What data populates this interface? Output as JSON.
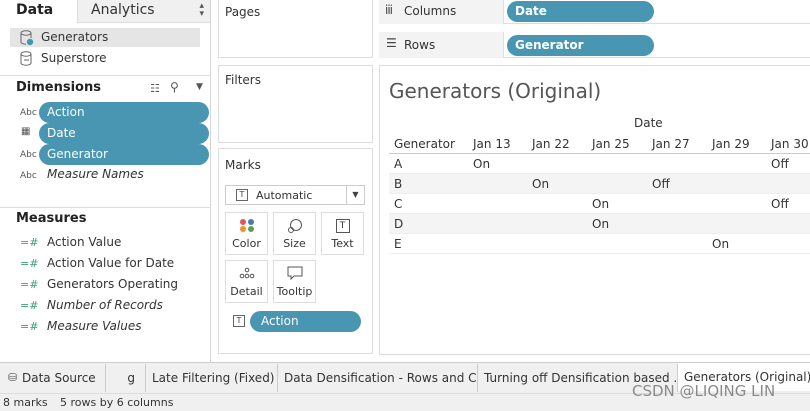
{
  "sidebar": {
    "tab_data": "Data",
    "tab_analytics": "Analytics",
    "datasources": [
      "Generators",
      "Superstore"
    ],
    "dimensions_title": "Dimensions",
    "dimensions": [
      {
        "type": "Abc",
        "label": "Action"
      },
      {
        "type": "date",
        "label": "Date"
      },
      {
        "type": "Abc",
        "label": "Generator"
      },
      {
        "type": "Abc",
        "label": "Measure Names"
      }
    ],
    "measures_title": "Measures",
    "measures": [
      "Action Value",
      "Action Value for Date",
      "Generators Operating",
      "Number of Records",
      "Measure Values"
    ]
  },
  "shelves": {
    "pages": "Pages",
    "filters": "Filters",
    "columns": "Columns",
    "rows": "Rows",
    "columns_pill": "Date",
    "rows_pill": "Generator"
  },
  "marks": {
    "title": "Marks",
    "type": "Automatic",
    "cards": [
      "Color",
      "Size",
      "Text",
      "Detail",
      "Tooltip"
    ],
    "text_pill": "Action"
  },
  "view": {
    "title": "Generators (Original)",
    "col_header": "Date",
    "row_header": "Generator",
    "columns": [
      "Jan 13",
      "Jan 22",
      "Jan 25",
      "Jan 27",
      "Jan 29",
      "Jan 30"
    ],
    "rows": [
      {
        "label": "A",
        "cells": [
          "On",
          "",
          "",
          "",
          "",
          "Off"
        ]
      },
      {
        "label": "B",
        "cells": [
          "",
          "On",
          "",
          "Off",
          "",
          ""
        ]
      },
      {
        "label": "C",
        "cells": [
          "",
          "",
          "On",
          "",
          "",
          "Off"
        ]
      },
      {
        "label": "D",
        "cells": [
          "",
          "",
          "On",
          "",
          "",
          ""
        ]
      },
      {
        "label": "E",
        "cells": [
          "",
          "",
          "",
          "",
          "On",
          ""
        ]
      }
    ]
  },
  "tabs": [
    "Data Source",
    "g",
    "Late Filtering (Fixed)",
    "Data Densification - Rows and C...",
    "Turning off Densification based ...",
    "Generators (Original)"
  ],
  "status": {
    "marks": "8 marks",
    "dims": "5 rows by 6 columns"
  },
  "watermark": "CSDN @LIQING LIN"
}
